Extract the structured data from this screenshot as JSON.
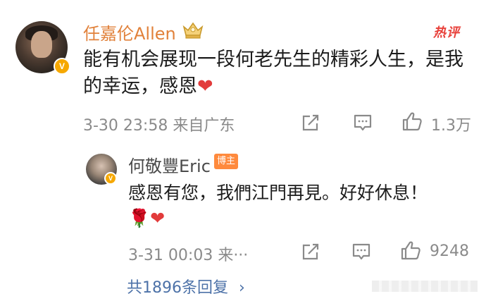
{
  "main_comment": {
    "author": "任嘉伦Allen",
    "verified_badge": "V",
    "hot_label": "热评",
    "text": "能有机会展现一段何老先生的精彩人生，是我的幸运，感恩",
    "heart": "❤",
    "meta": "3-30 23:58 来自广东",
    "likes": "1.3万"
  },
  "reply": {
    "author": "何敬豐Eric",
    "tag": "博主",
    "verified_badge": "V",
    "text": "感恩有您，我們江門再見。好好休息！",
    "emoji": "🌹❤",
    "meta": "3-31 00:03 来···",
    "likes": "9248"
  },
  "more_replies": {
    "label": "共1896条回复",
    "arrow": "›"
  },
  "icons": [
    "share-icon",
    "comment-icon",
    "like-icon",
    "crown-icon"
  ]
}
